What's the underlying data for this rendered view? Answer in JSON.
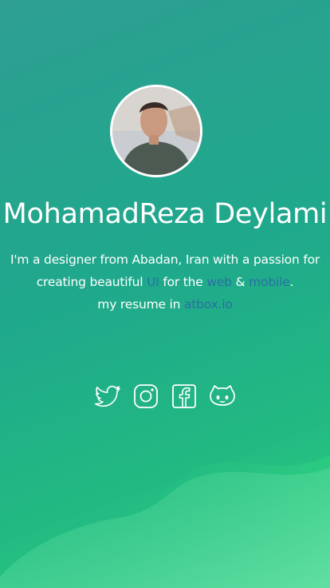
{
  "profile": {
    "name": "MohamadReza Deylami",
    "avatar_alt": "profile photo"
  },
  "bio": {
    "line1": "I'm a designer from Abadan, Iran with a passion for",
    "line2_prefix": "creating beautiful ",
    "ui_link": "UI",
    "line2_mid1": " for the ",
    "web_link": "web",
    "line2_mid2": " & ",
    "mobile_link": "mobile",
    "line2_suffix": ".",
    "line3_prefix": "my resume in ",
    "resume_link": "atbox.io"
  },
  "socials": [
    {
      "name": "twitter",
      "icon": "twitter-icon"
    },
    {
      "name": "instagram",
      "icon": "instagram-icon"
    },
    {
      "name": "facebook",
      "icon": "facebook-icon"
    },
    {
      "name": "github",
      "icon": "github-icon"
    }
  ],
  "colors": {
    "background_start": "#2e9f92",
    "background_end": "#2dd37f",
    "link": "#2a6fa3",
    "text": "#ffffff"
  }
}
